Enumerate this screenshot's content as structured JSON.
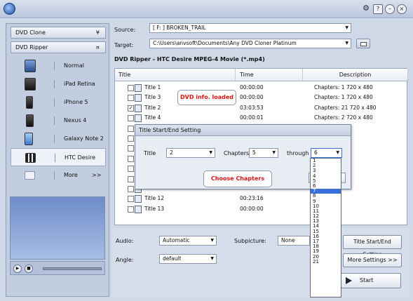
{
  "window": {
    "minimize": "–",
    "close": "×",
    "settings": "⚙",
    "help": "?"
  },
  "sidebar": {
    "dvd_clone": "DVD Clone",
    "dvd_ripper": "DVD Ripper",
    "devices": [
      {
        "label": "Normal"
      },
      {
        "label": "iPad Retina"
      },
      {
        "label": "iPhone 5"
      },
      {
        "label": "Nexus 4"
      },
      {
        "label": "Galaxy Note 2"
      },
      {
        "label": "HTC Desire"
      },
      {
        "label": "More"
      }
    ],
    "more_arrow": ">>"
  },
  "source": {
    "label": "Source:",
    "value": "[ F: ] BROKEN_TRAIL"
  },
  "target": {
    "label": "Target:",
    "value": "C:\\Users\\anvsoft\\Documents\\Any DVD Cloner Platinum"
  },
  "profile_title": "DVD Ripper - HTC Desire MPEG-4 Movie (*.mp4)",
  "table": {
    "headers": {
      "title": "Title",
      "time": "Time",
      "description": "Description"
    },
    "rows": [
      {
        "title": "Title 1",
        "time": "00:00:00",
        "desc": "Chapters: 1   720 x 480",
        "checked": false
      },
      {
        "title": "Title 3",
        "time": "00:00:00",
        "desc": "Chapters: 1   720 x 480",
        "checked": false
      },
      {
        "title": "Title 2",
        "time": "03:03:53",
        "desc": "Chapters: 21  720 x 480",
        "checked": true
      },
      {
        "title": "Title 4",
        "time": "00:00:01",
        "desc": "Chapters: 2   720 x 480",
        "checked": false
      },
      {
        "title": "",
        "time": "",
        "desc": "x 480",
        "checked": false
      },
      {
        "title": "",
        "time": "",
        "desc": "x 480",
        "checked": false
      },
      {
        "title": "",
        "time": "",
        "desc": "x 480",
        "checked": false
      },
      {
        "title": "",
        "time": "",
        "desc": "x 480",
        "checked": false
      },
      {
        "title": "",
        "time": "",
        "desc": "x 480",
        "checked": false
      },
      {
        "title": "",
        "time": "",
        "desc": "x 480",
        "checked": false
      },
      {
        "title": "",
        "time": "",
        "desc": "x 480",
        "checked": false
      },
      {
        "title": "Title 12",
        "time": "00:23:16",
        "desc": "720 x 480",
        "checked": false
      },
      {
        "title": "Title 13",
        "time": "00:00:00",
        "desc": "720 x 480",
        "checked": false
      }
    ]
  },
  "callouts": {
    "dvd_info": "DVD info. loaded",
    "choose_chapters": "Choose Chapters"
  },
  "dialog": {
    "title": "Title Start/End Setting",
    "title_label": "Title",
    "title_value": "2",
    "chapters_label": "Chapters",
    "chapters_value": "5",
    "through_label": "through",
    "through_value": "6"
  },
  "dropdown_options": [
    "1",
    "2",
    "3",
    "4",
    "5",
    "6",
    "7",
    "8",
    "9",
    "10",
    "11",
    "12",
    "13",
    "14",
    "15",
    "16",
    "17",
    "18",
    "19",
    "20",
    "21"
  ],
  "dropdown_selected": "7",
  "bottom": {
    "audio_label": "Audio:",
    "audio_value": "Automatic",
    "subpicture_label": "Subpicture:",
    "subpicture_value": "None",
    "angle_label": "Angle:",
    "angle_value": "default",
    "title_setting_button": "Title Start/End Setting",
    "more_settings_button": "More Settings >>",
    "start_button": "Start"
  }
}
